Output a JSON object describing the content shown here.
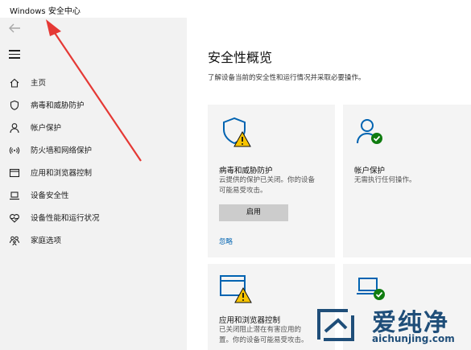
{
  "window": {
    "title": "Windows 安全中心"
  },
  "sidebar": {
    "items": [
      {
        "label": "主页",
        "icon": "home-icon"
      },
      {
        "label": "病毒和威胁防护",
        "icon": "shield-icon"
      },
      {
        "label": "帐户保护",
        "icon": "person-icon"
      },
      {
        "label": "防火墙和网络保护",
        "icon": "wifi-icon"
      },
      {
        "label": "应用和浏览器控制",
        "icon": "app-window-icon"
      },
      {
        "label": "设备安全性",
        "icon": "laptop-icon"
      },
      {
        "label": "设备性能和运行状况",
        "icon": "heart-icon"
      },
      {
        "label": "家庭选项",
        "icon": "family-icon"
      }
    ]
  },
  "main": {
    "title": "安全性概览",
    "subtitle": "了解设备当前的安全性和运行情况并采取必要操作。",
    "cards": [
      {
        "title": "病毒和威胁防护",
        "desc_line1": "云提供的保护已关闭。你的设备",
        "desc_line2": "可能易受攻击。",
        "button": "启用",
        "link": "忽略"
      },
      {
        "title": "帐户保护",
        "desc_line1": "无需执行任何操作。"
      },
      {
        "title": "应用和浏览器控制",
        "desc_line1": "已关闭阻止潜在有害应用的",
        "desc_line2": "置。你的设备可能易受攻击。"
      },
      {
        "title": ""
      }
    ]
  },
  "watermark": {
    "brand": "爱纯净",
    "url": "aichunjing.com"
  },
  "colors": {
    "accent": "#0063b1",
    "warning": "#f8c400",
    "ok": "#107c10",
    "arrow": "#e53935"
  }
}
